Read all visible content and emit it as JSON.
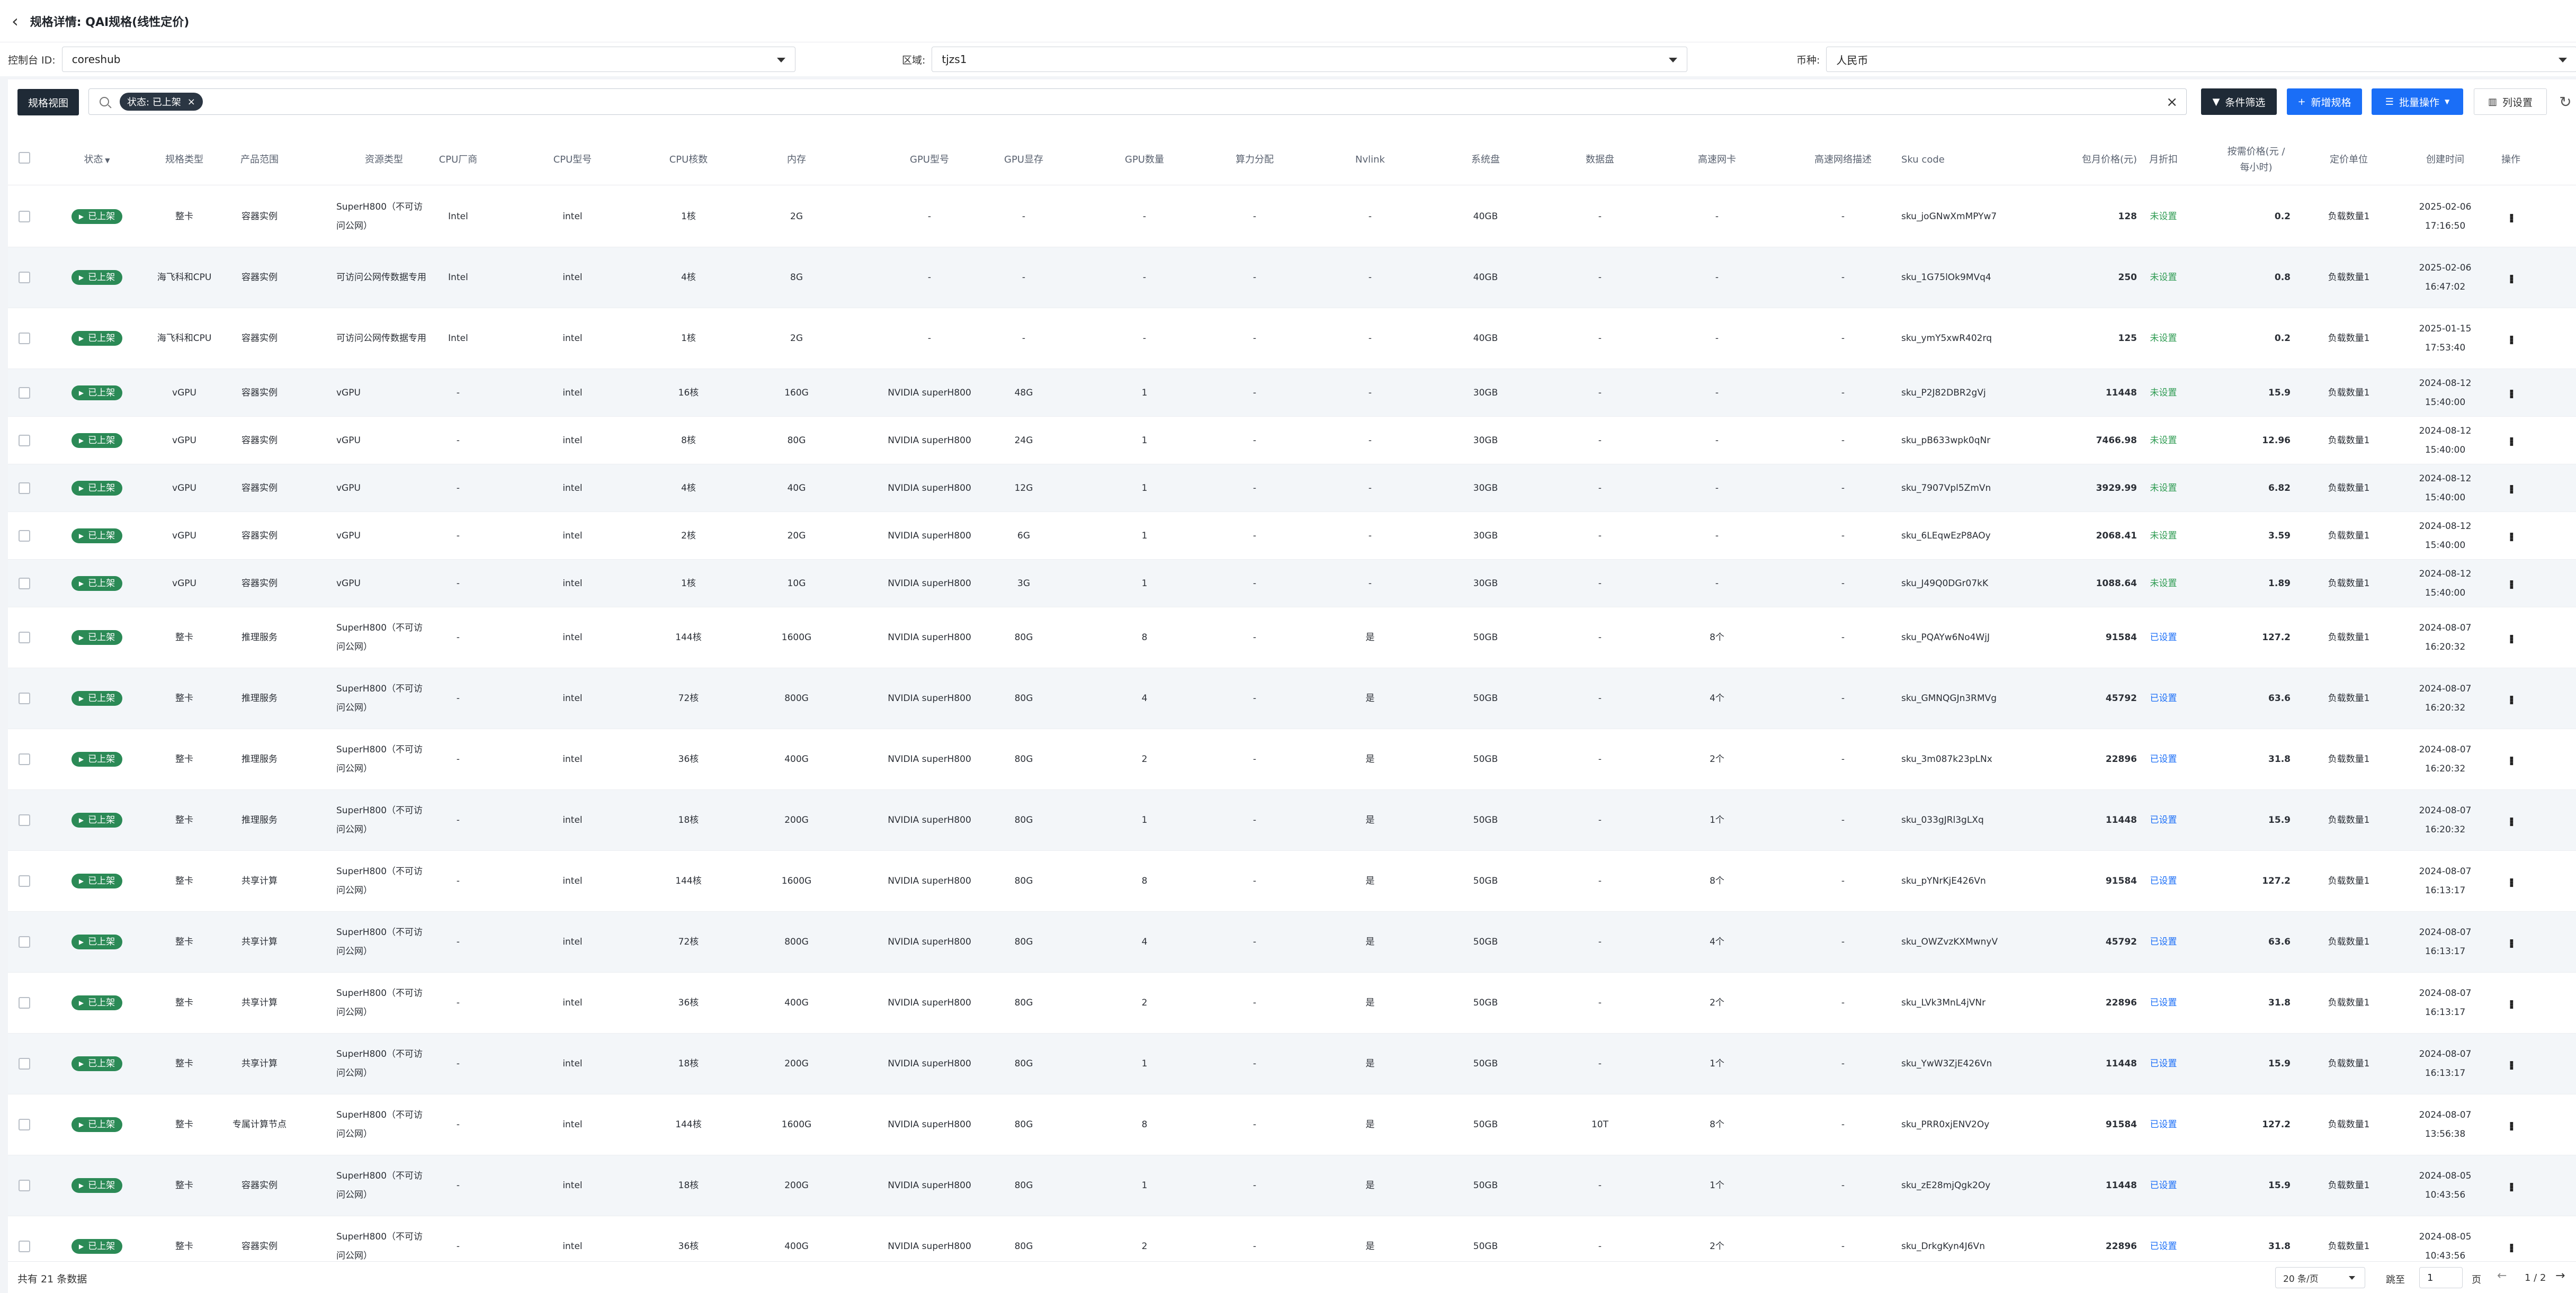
{
  "header": {
    "title": "规格详情: QAI规格(线性定价)"
  },
  "filters": {
    "console_label": "控制台 ID:",
    "console_value": "coreshub",
    "region_label": "区域:",
    "region_value": "tjzs1",
    "currency_label": "币种:",
    "currency_value": "人民币"
  },
  "toolbar": {
    "view_label": "规格视图",
    "tag_label": "状态: 已上架",
    "filter_label": "条件筛选",
    "new_label": "新增规格",
    "batch_label": "批量操作",
    "columns_label": "列设置"
  },
  "columns": [
    "状态",
    "规格类型",
    "产品范围",
    "资源类型",
    "CPU厂商",
    "CPU型号",
    "CPU核数",
    "内存",
    "GPU型号",
    "GPU显存",
    "GPU数量",
    "算力分配",
    "Nvlink",
    "系统盘",
    "数据盘",
    "高速网卡",
    "高速网络描述",
    "Sku code",
    "包月价格(元)",
    "月折扣",
    "按需价格(元 / 每小时)",
    "定价单位",
    "创建时间",
    "操作"
  ],
  "colors": {
    "status_green": "#2b8a56",
    "unset_green": "#2e9b52",
    "set_blue": "#1a6ef7",
    "primary": "#1a6ef7",
    "dark": "#1f2a36"
  },
  "rows": [
    {
      "status": "已上架",
      "spec": "整卡",
      "scope": "容器实例",
      "resource": "SuperH800（不可访问公网）",
      "cpu_vendor": "Intel",
      "cpu_model": "intel",
      "cores": "1核",
      "mem": "2G",
      "gpu_model": "-",
      "gpu_mem": "-",
      "gpu_count": "-",
      "compute": "-",
      "nvlink": "-",
      "sysdisk": "40GB",
      "datadisk": "-",
      "nic": "-",
      "net_desc": "-",
      "sku": "sku_joGNwXmMPYw7",
      "monthly": "128",
      "discount": "未设置",
      "hourly": "0.2",
      "unit": "负载数量1",
      "created": "2025-02-06 17:16:50"
    },
    {
      "status": "已上架",
      "spec": "海飞科和CPU",
      "scope": "容器实例",
      "resource": "可访问公网传数据专用",
      "cpu_vendor": "Intel",
      "cpu_model": "intel",
      "cores": "4核",
      "mem": "8G",
      "gpu_model": "-",
      "gpu_mem": "-",
      "gpu_count": "-",
      "compute": "-",
      "nvlink": "-",
      "sysdisk": "40GB",
      "datadisk": "-",
      "nic": "-",
      "net_desc": "-",
      "sku": "sku_1G75lOk9MVq4",
      "monthly": "250",
      "discount": "未设置",
      "hourly": "0.8",
      "unit": "负载数量1",
      "created": "2025-02-06 16:47:02"
    },
    {
      "status": "已上架",
      "spec": "海飞科和CPU",
      "scope": "容器实例",
      "resource": "可访问公网传数据专用",
      "cpu_vendor": "Intel",
      "cpu_model": "intel",
      "cores": "1核",
      "mem": "2G",
      "gpu_model": "-",
      "gpu_mem": "-",
      "gpu_count": "-",
      "compute": "-",
      "nvlink": "-",
      "sysdisk": "40GB",
      "datadisk": "-",
      "nic": "-",
      "net_desc": "-",
      "sku": "sku_ymY5xwR402rq",
      "monthly": "125",
      "discount": "未设置",
      "hourly": "0.2",
      "unit": "负载数量1",
      "created": "2025-01-15 17:53:40"
    },
    {
      "status": "已上架",
      "spec": "vGPU",
      "scope": "容器实例",
      "resource": "vGPU",
      "cpu_vendor": "-",
      "cpu_model": "intel",
      "cores": "16核",
      "mem": "160G",
      "gpu_model": "NVIDIA superH800",
      "gpu_mem": "48G",
      "gpu_count": "1",
      "compute": "-",
      "nvlink": "-",
      "sysdisk": "30GB",
      "datadisk": "-",
      "nic": "-",
      "net_desc": "-",
      "sku": "sku_P2J82DBR2gVj",
      "monthly": "11448",
      "discount": "未设置",
      "hourly": "15.9",
      "unit": "负载数量1",
      "created": "2024-08-12 15:40:00"
    },
    {
      "status": "已上架",
      "spec": "vGPU",
      "scope": "容器实例",
      "resource": "vGPU",
      "cpu_vendor": "-",
      "cpu_model": "intel",
      "cores": "8核",
      "mem": "80G",
      "gpu_model": "NVIDIA superH800",
      "gpu_mem": "24G",
      "gpu_count": "1",
      "compute": "-",
      "nvlink": "-",
      "sysdisk": "30GB",
      "datadisk": "-",
      "nic": "-",
      "net_desc": "-",
      "sku": "sku_pB633wpk0qNr",
      "monthly": "7466.98",
      "discount": "未设置",
      "hourly": "12.96",
      "unit": "负载数量1",
      "created": "2024-08-12 15:40:00"
    },
    {
      "status": "已上架",
      "spec": "vGPU",
      "scope": "容器实例",
      "resource": "vGPU",
      "cpu_vendor": "-",
      "cpu_model": "intel",
      "cores": "4核",
      "mem": "40G",
      "gpu_model": "NVIDIA superH800",
      "gpu_mem": "12G",
      "gpu_count": "1",
      "compute": "-",
      "nvlink": "-",
      "sysdisk": "30GB",
      "datadisk": "-",
      "nic": "-",
      "net_desc": "-",
      "sku": "sku_7907Vpl5ZmVn",
      "monthly": "3929.99",
      "discount": "未设置",
      "hourly": "6.82",
      "unit": "负载数量1",
      "created": "2024-08-12 15:40:00"
    },
    {
      "status": "已上架",
      "spec": "vGPU",
      "scope": "容器实例",
      "resource": "vGPU",
      "cpu_vendor": "-",
      "cpu_model": "intel",
      "cores": "2核",
      "mem": "20G",
      "gpu_model": "NVIDIA superH800",
      "gpu_mem": "6G",
      "gpu_count": "1",
      "compute": "-",
      "nvlink": "-",
      "sysdisk": "30GB",
      "datadisk": "-",
      "nic": "-",
      "net_desc": "-",
      "sku": "sku_6LEqwEzP8AOy",
      "monthly": "2068.41",
      "discount": "未设置",
      "hourly": "3.59",
      "unit": "负载数量1",
      "created": "2024-08-12 15:40:00"
    },
    {
      "status": "已上架",
      "spec": "vGPU",
      "scope": "容器实例",
      "resource": "vGPU",
      "cpu_vendor": "-",
      "cpu_model": "intel",
      "cores": "1核",
      "mem": "10G",
      "gpu_model": "NVIDIA superH800",
      "gpu_mem": "3G",
      "gpu_count": "1",
      "compute": "-",
      "nvlink": "-",
      "sysdisk": "30GB",
      "datadisk": "-",
      "nic": "-",
      "net_desc": "-",
      "sku": "sku_J49Q0DGr07kK",
      "monthly": "1088.64",
      "discount": "未设置",
      "hourly": "1.89",
      "unit": "负载数量1",
      "created": "2024-08-12 15:40:00"
    },
    {
      "status": "已上架",
      "spec": "整卡",
      "scope": "推理服务",
      "resource": "SuperH800（不可访问公网）",
      "cpu_vendor": "-",
      "cpu_model": "intel",
      "cores": "144核",
      "mem": "1600G",
      "gpu_model": "NVIDIA superH800",
      "gpu_mem": "80G",
      "gpu_count": "8",
      "compute": "-",
      "nvlink": "是",
      "sysdisk": "50GB",
      "datadisk": "-",
      "nic": "8个",
      "net_desc": "-",
      "sku": "sku_PQAYw6No4WjJ",
      "monthly": "91584",
      "discount": "已设置",
      "hourly": "127.2",
      "unit": "负载数量1",
      "created": "2024-08-07 16:20:32"
    },
    {
      "status": "已上架",
      "spec": "整卡",
      "scope": "推理服务",
      "resource": "SuperH800（不可访问公网）",
      "cpu_vendor": "-",
      "cpu_model": "intel",
      "cores": "72核",
      "mem": "800G",
      "gpu_model": "NVIDIA superH800",
      "gpu_mem": "80G",
      "gpu_count": "4",
      "compute": "-",
      "nvlink": "是",
      "sysdisk": "50GB",
      "datadisk": "-",
      "nic": "4个",
      "net_desc": "-",
      "sku": "sku_GMNQGJn3RMVg",
      "monthly": "45792",
      "discount": "已设置",
      "hourly": "63.6",
      "unit": "负载数量1",
      "created": "2024-08-07 16:20:32"
    },
    {
      "status": "已上架",
      "spec": "整卡",
      "scope": "推理服务",
      "resource": "SuperH800（不可访问公网）",
      "cpu_vendor": "-",
      "cpu_model": "intel",
      "cores": "36核",
      "mem": "400G",
      "gpu_model": "NVIDIA superH800",
      "gpu_mem": "80G",
      "gpu_count": "2",
      "compute": "-",
      "nvlink": "是",
      "sysdisk": "50GB",
      "datadisk": "-",
      "nic": "2个",
      "net_desc": "-",
      "sku": "sku_3m087k23pLNx",
      "monthly": "22896",
      "discount": "已设置",
      "hourly": "31.8",
      "unit": "负载数量1",
      "created": "2024-08-07 16:20:32"
    },
    {
      "status": "已上架",
      "spec": "整卡",
      "scope": "推理服务",
      "resource": "SuperH800（不可访问公网）",
      "cpu_vendor": "-",
      "cpu_model": "intel",
      "cores": "18核",
      "mem": "200G",
      "gpu_model": "NVIDIA superH800",
      "gpu_mem": "80G",
      "gpu_count": "1",
      "compute": "-",
      "nvlink": "是",
      "sysdisk": "50GB",
      "datadisk": "-",
      "nic": "1个",
      "net_desc": "-",
      "sku": "sku_033gJRl3gLXq",
      "monthly": "11448",
      "discount": "已设置",
      "hourly": "15.9",
      "unit": "负载数量1",
      "created": "2024-08-07 16:20:32"
    },
    {
      "status": "已上架",
      "spec": "整卡",
      "scope": "共享计算",
      "resource": "SuperH800（不可访问公网）",
      "cpu_vendor": "-",
      "cpu_model": "intel",
      "cores": "144核",
      "mem": "1600G",
      "gpu_model": "NVIDIA superH800",
      "gpu_mem": "80G",
      "gpu_count": "8",
      "compute": "-",
      "nvlink": "是",
      "sysdisk": "50GB",
      "datadisk": "-",
      "nic": "8个",
      "net_desc": "-",
      "sku": "sku_pYNrKjE426Vn",
      "monthly": "91584",
      "discount": "已设置",
      "hourly": "127.2",
      "unit": "负载数量1",
      "created": "2024-08-07 16:13:17"
    },
    {
      "status": "已上架",
      "spec": "整卡",
      "scope": "共享计算",
      "resource": "SuperH800（不可访问公网）",
      "cpu_vendor": "-",
      "cpu_model": "intel",
      "cores": "72核",
      "mem": "800G",
      "gpu_model": "NVIDIA superH800",
      "gpu_mem": "80G",
      "gpu_count": "4",
      "compute": "-",
      "nvlink": "是",
      "sysdisk": "50GB",
      "datadisk": "-",
      "nic": "4个",
      "net_desc": "-",
      "sku": "sku_OWZvzKXMwnyV",
      "monthly": "45792",
      "discount": "已设置",
      "hourly": "63.6",
      "unit": "负载数量1",
      "created": "2024-08-07 16:13:17"
    },
    {
      "status": "已上架",
      "spec": "整卡",
      "scope": "共享计算",
      "resource": "SuperH800（不可访问公网）",
      "cpu_vendor": "-",
      "cpu_model": "intel",
      "cores": "36核",
      "mem": "400G",
      "gpu_model": "NVIDIA superH800",
      "gpu_mem": "80G",
      "gpu_count": "2",
      "compute": "-",
      "nvlink": "是",
      "sysdisk": "50GB",
      "datadisk": "-",
      "nic": "2个",
      "net_desc": "-",
      "sku": "sku_LVk3MnL4jVNr",
      "monthly": "22896",
      "discount": "已设置",
      "hourly": "31.8",
      "unit": "负载数量1",
      "created": "2024-08-07 16:13:17"
    },
    {
      "status": "已上架",
      "spec": "整卡",
      "scope": "共享计算",
      "resource": "SuperH800（不可访问公网）",
      "cpu_vendor": "-",
      "cpu_model": "intel",
      "cores": "18核",
      "mem": "200G",
      "gpu_model": "NVIDIA superH800",
      "gpu_mem": "80G",
      "gpu_count": "1",
      "compute": "-",
      "nvlink": "是",
      "sysdisk": "50GB",
      "datadisk": "-",
      "nic": "1个",
      "net_desc": "-",
      "sku": "sku_YwW3ZjE426Vn",
      "monthly": "11448",
      "discount": "已设置",
      "hourly": "15.9",
      "unit": "负载数量1",
      "created": "2024-08-07 16:13:17"
    },
    {
      "status": "已上架",
      "spec": "整卡",
      "scope": "专属计算节点",
      "resource": "SuperH800（不可访问公网）",
      "cpu_vendor": "-",
      "cpu_model": "intel",
      "cores": "144核",
      "mem": "1600G",
      "gpu_model": "NVIDIA superH800",
      "gpu_mem": "80G",
      "gpu_count": "8",
      "compute": "-",
      "nvlink": "是",
      "sysdisk": "50GB",
      "datadisk": "10T",
      "nic": "8个",
      "net_desc": "-",
      "sku": "sku_PRR0xjENV2Oy",
      "monthly": "91584",
      "discount": "已设置",
      "hourly": "127.2",
      "unit": "负载数量1",
      "created": "2024-08-07 13:56:38"
    },
    {
      "status": "已上架",
      "spec": "整卡",
      "scope": "容器实例",
      "resource": "SuperH800（不可访问公网）",
      "cpu_vendor": "-",
      "cpu_model": "intel",
      "cores": "18核",
      "mem": "200G",
      "gpu_model": "NVIDIA superH800",
      "gpu_mem": "80G",
      "gpu_count": "1",
      "compute": "-",
      "nvlink": "是",
      "sysdisk": "50GB",
      "datadisk": "-",
      "nic": "1个",
      "net_desc": "-",
      "sku": "sku_zE28mjQgk2Oy",
      "monthly": "11448",
      "discount": "已设置",
      "hourly": "15.9",
      "unit": "负载数量1",
      "created": "2024-08-05 10:43:56"
    },
    {
      "status": "已上架",
      "spec": "整卡",
      "scope": "容器实例",
      "resource": "SuperH800（不可访问公网）",
      "cpu_vendor": "-",
      "cpu_model": "intel",
      "cores": "36核",
      "mem": "400G",
      "gpu_model": "NVIDIA superH800",
      "gpu_mem": "80G",
      "gpu_count": "2",
      "compute": "-",
      "nvlink": "是",
      "sysdisk": "50GB",
      "datadisk": "-",
      "nic": "2个",
      "net_desc": "-",
      "sku": "sku_DrkgKyn4J6Vn",
      "monthly": "22896",
      "discount": "已设置",
      "hourly": "31.8",
      "unit": "负载数量1",
      "created": "2024-08-05 10:43:56"
    }
  ],
  "footer": {
    "total": "共有 21 条数据",
    "page_size": "20 条/页",
    "jump_label": "跳至",
    "jump_value": "1",
    "page_unit": "页",
    "page_info": "1 / 2"
  }
}
